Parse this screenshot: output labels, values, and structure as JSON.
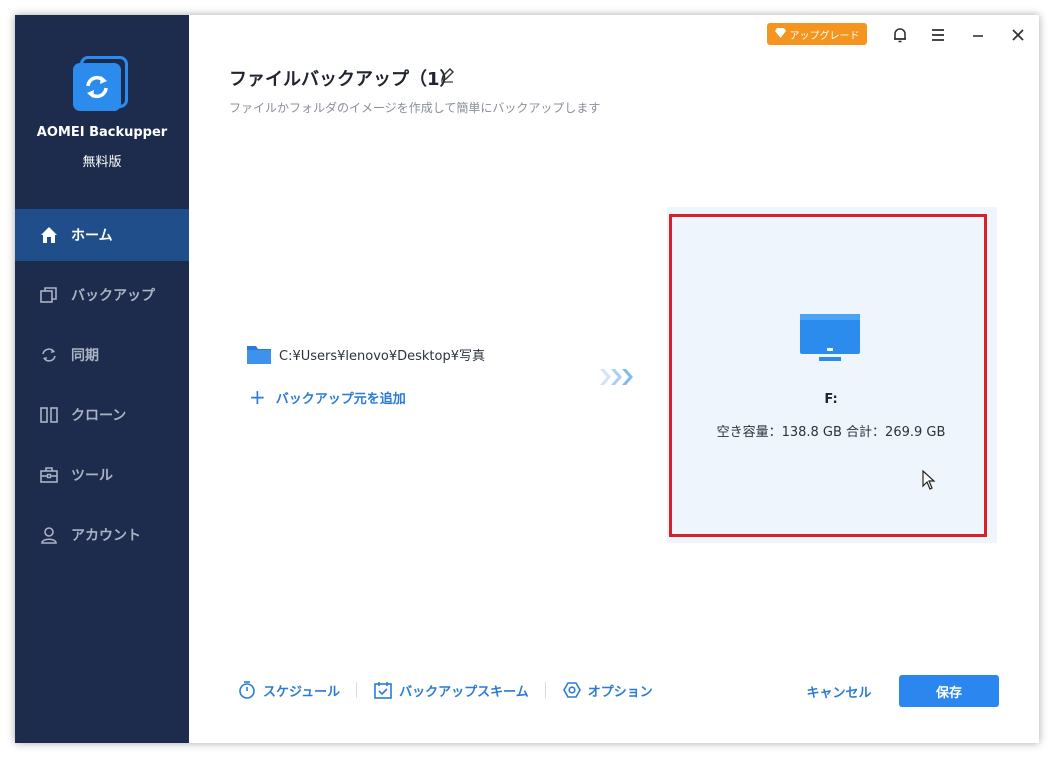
{
  "app": {
    "name": "AOMEI Backupper",
    "edition": "無料版"
  },
  "sidebar": {
    "items": [
      {
        "label": "ホーム",
        "icon": "home-icon",
        "active": true
      },
      {
        "label": "バックアップ",
        "icon": "backup-icon",
        "active": false
      },
      {
        "label": "同期",
        "icon": "sync-icon",
        "active": false
      },
      {
        "label": "クローン",
        "icon": "clone-icon",
        "active": false
      },
      {
        "label": "ツール",
        "icon": "toolbox-icon",
        "active": false
      },
      {
        "label": "アカウント",
        "icon": "user-icon",
        "active": false
      }
    ]
  },
  "titlebar": {
    "upgrade_label": "アップグレード"
  },
  "page": {
    "title": "ファイルバックアップ（1）",
    "subtitle": "ファイルかフォルダのイメージを作成して簡単にバックアップします"
  },
  "source": {
    "path": "C:¥Users¥lenovo¥Desktop¥写真",
    "add_label": "バックアップ元を追加"
  },
  "destination": {
    "drive": "F:",
    "capacity": "空き容量：138.8 GB 合計：269.9 GB"
  },
  "bottom": {
    "schedule_label": "スケジュール",
    "scheme_label": "バックアップスキーム",
    "options_label": "オプション",
    "cancel_label": "キャンセル",
    "save_label": "保存"
  },
  "colors": {
    "sidebar_bg": "#1d2c4c",
    "active_nav": "#1f4e8a",
    "accent": "#2b86f0",
    "upgrade": "#f5941f",
    "highlight_border": "#d81f2a"
  }
}
